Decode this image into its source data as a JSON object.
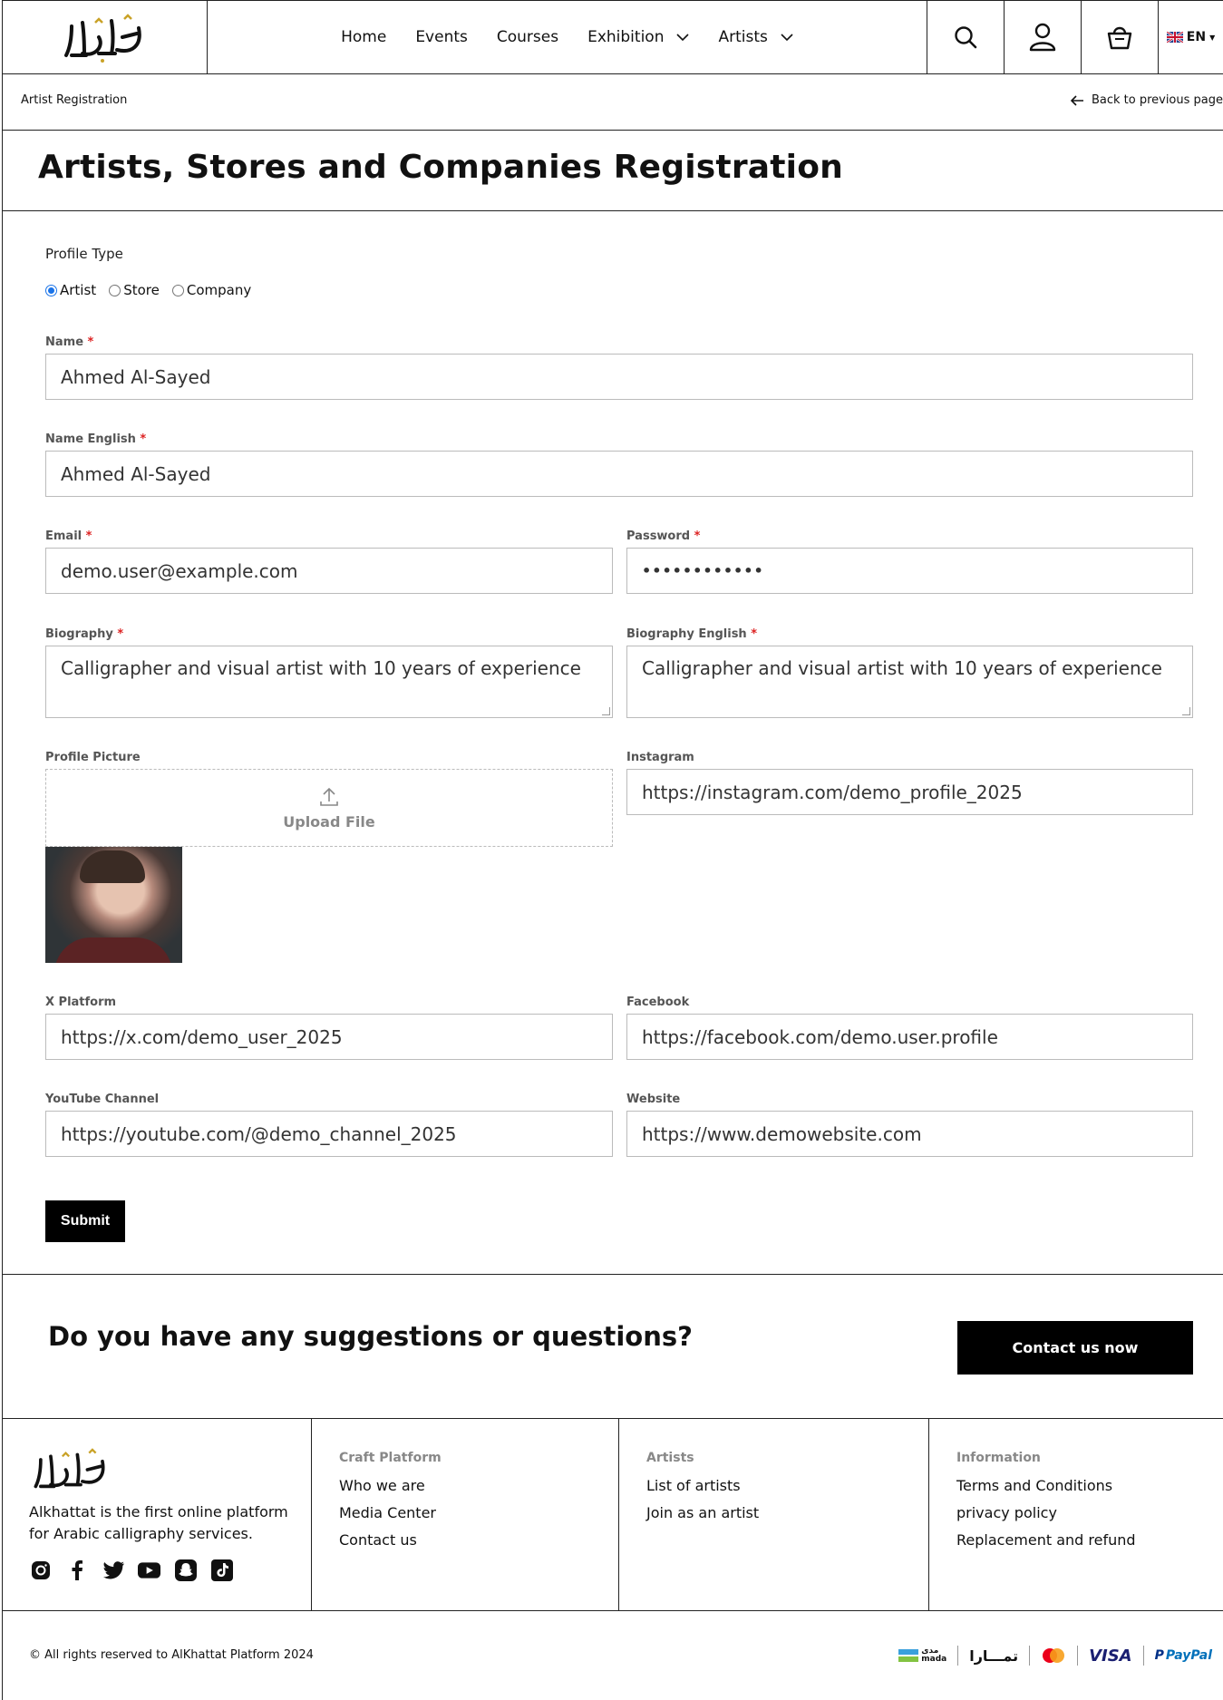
{
  "header": {
    "logo_alt": "الخطاط",
    "nav": [
      {
        "label": "Home",
        "dropdown": false
      },
      {
        "label": "Events",
        "dropdown": false
      },
      {
        "label": "Courses",
        "dropdown": false
      },
      {
        "label": "Exhibition",
        "dropdown": true
      },
      {
        "label": "Artists",
        "dropdown": true
      }
    ],
    "icons": [
      "search-icon",
      "user-icon",
      "cart-icon"
    ],
    "language": "EN"
  },
  "breadcrumb": {
    "current": "Artist Registration",
    "back": "Back to previous page"
  },
  "page_title": "Artists, Stores and Companies Registration",
  "form": {
    "profile_type_label": "Profile Type",
    "profile_types": [
      "Artist",
      "Store",
      "Company"
    ],
    "selected_profile_type": "Artist",
    "required_mark": "*",
    "name": {
      "label": "Name",
      "value": "Ahmed Al-Sayed"
    },
    "name_english": {
      "label": "Name English",
      "value": "Ahmed Al-Sayed"
    },
    "email": {
      "label": "Email",
      "value": "demo.user@example.com"
    },
    "password": {
      "label": "Password",
      "value": "••••••••••••"
    },
    "biography": {
      "label": "Biography",
      "value": "Calligrapher and visual artist with 10 years of experience"
    },
    "biography_english": {
      "label": "Biography English",
      "value": "Calligrapher and visual artist with 10 years of experience"
    },
    "profile_picture": {
      "label": "Profile Picture",
      "upload_label": "Upload File"
    },
    "instagram": {
      "label": "Instagram",
      "value": "https://instagram.com/demo_profile_2025"
    },
    "x_platform": {
      "label": "X Platform",
      "value": "https://x.com/demo_user_2025"
    },
    "facebook": {
      "label": "Facebook",
      "value": "https://facebook.com/demo.user.profile"
    },
    "youtube": {
      "label": "YouTube Channel",
      "value": "https://youtube.com/@demo_channel_2025"
    },
    "website": {
      "label": "Website",
      "value": "https://www.demowebsite.com"
    },
    "submit_label": "Submit"
  },
  "contact_band": {
    "question": "Do you have any suggestions or questions?",
    "button": "Contact us now"
  },
  "footer": {
    "about": "Alkhattat is the first online platform for Arabic calligraphy services.",
    "socials": [
      "instagram-icon",
      "facebook-icon",
      "twitter-icon",
      "youtube-icon",
      "snapchat-icon",
      "tiktok-icon"
    ],
    "columns": [
      {
        "heading": "Craft Platform",
        "links": [
          "Who we are",
          "Media Center",
          "Contact us"
        ]
      },
      {
        "heading": "Artists",
        "links": [
          "List of artists",
          "Join as an artist"
        ]
      },
      {
        "heading": "Information",
        "links": [
          "Terms and Conditions",
          "privacy policy",
          "Replacement and refund"
        ]
      }
    ],
    "copyright": "© All rights reserved to AlKhattat Platform 2024",
    "payments": {
      "mada": "mada",
      "mada_ar": "مدى",
      "tamara": "تمـــارا",
      "visa": "VISA",
      "paypal": "PayPal"
    }
  }
}
